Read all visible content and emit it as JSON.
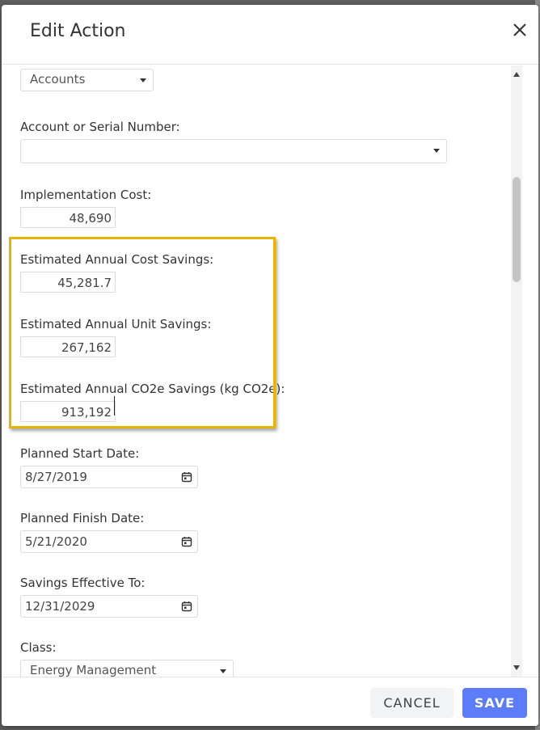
{
  "dialog": {
    "title": "Edit Action",
    "close_icon": "close-icon"
  },
  "form": {
    "type_select": {
      "value": "Accounts"
    },
    "account_serial": {
      "label": "Account or Serial Number:",
      "value": ""
    },
    "implementation_cost": {
      "label": "Implementation Cost:",
      "value": "48,690"
    },
    "annual_cost_savings": {
      "label": "Estimated Annual Cost Savings:",
      "value": "45,281.7"
    },
    "annual_unit_savings": {
      "label": "Estimated Annual Unit Savings:",
      "value": "267,162"
    },
    "annual_co2e_savings": {
      "label": "Estimated Annual CO2e Savings (kg CO2e):",
      "value": "913,192"
    },
    "planned_start": {
      "label": "Planned Start Date:",
      "value": "8/27/2019"
    },
    "planned_finish": {
      "label": "Planned Finish Date:",
      "value": "5/21/2020"
    },
    "savings_effective_to": {
      "label": "Savings Effective To:",
      "value": "12/31/2029"
    },
    "class": {
      "label": "Class:",
      "value": "Energy Management"
    }
  },
  "footer": {
    "cancel_label": "CANCEL",
    "save_label": "SAVE"
  },
  "colors": {
    "highlight": "#e8b400",
    "primary": "#5c7cfa"
  }
}
